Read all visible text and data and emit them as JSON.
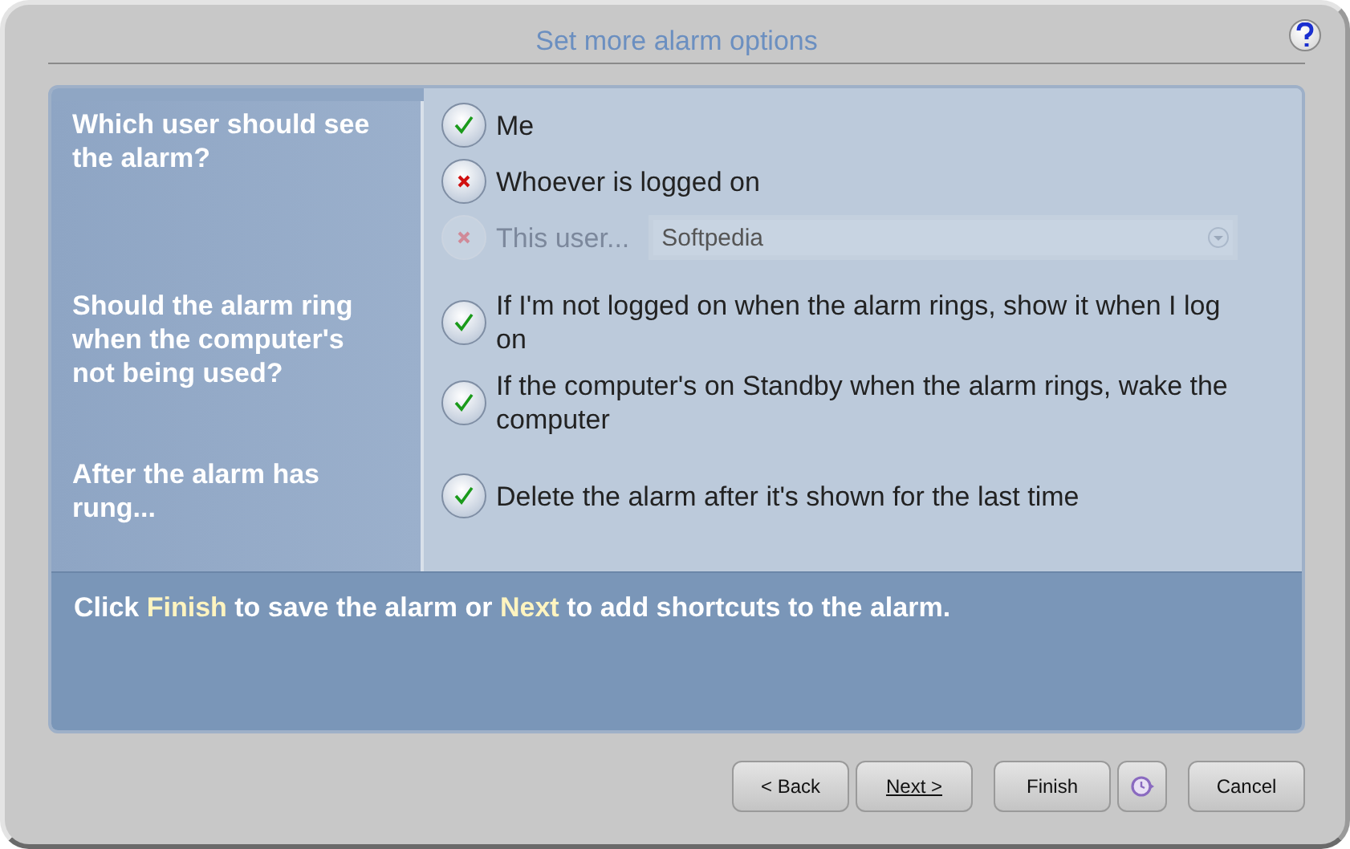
{
  "window": {
    "title": "Set more alarm options"
  },
  "sections": [
    {
      "question": "Which user should see the alarm?",
      "options": [
        {
          "label": "Me",
          "kind": "ticked",
          "disabled": false
        },
        {
          "label": "Whoever is logged on",
          "kind": "crossed",
          "disabled": false
        },
        {
          "label": "This user...",
          "kind": "crossed",
          "disabled": true,
          "dropdown": {
            "value": "Softpedia"
          }
        }
      ]
    },
    {
      "question": "Should the alarm ring when the computer's not being used?",
      "options": [
        {
          "label": "If I'm not logged on when the alarm rings, show it when I log on",
          "kind": "ticked",
          "disabled": false
        },
        {
          "label": "If the computer's on Standby when the alarm rings, wake the computer",
          "kind": "ticked",
          "disabled": false
        }
      ]
    },
    {
      "question": "After the alarm has rung...",
      "options": [
        {
          "label": "Delete the alarm after it's shown for the last time",
          "kind": "ticked",
          "disabled": false
        }
      ]
    }
  ],
  "info": [
    {
      "text": "Click ",
      "highlight": false
    },
    {
      "text": "Finish",
      "highlight": true
    },
    {
      "text": " to save the alarm or ",
      "highlight": false
    },
    {
      "text": "Next",
      "highlight": true
    },
    {
      "text": " to add shortcuts to the alarm.",
      "highlight": false
    }
  ],
  "buttons": [
    {
      "kind": "text",
      "label": "< Back",
      "underline": false
    },
    {
      "kind": "text",
      "label": "Next >",
      "underline": true
    },
    {
      "kind": "text",
      "label": "Finish",
      "underline": false
    },
    {
      "kind": "icon"
    },
    {
      "kind": "text",
      "label": "Cancel",
      "underline": false
    }
  ]
}
